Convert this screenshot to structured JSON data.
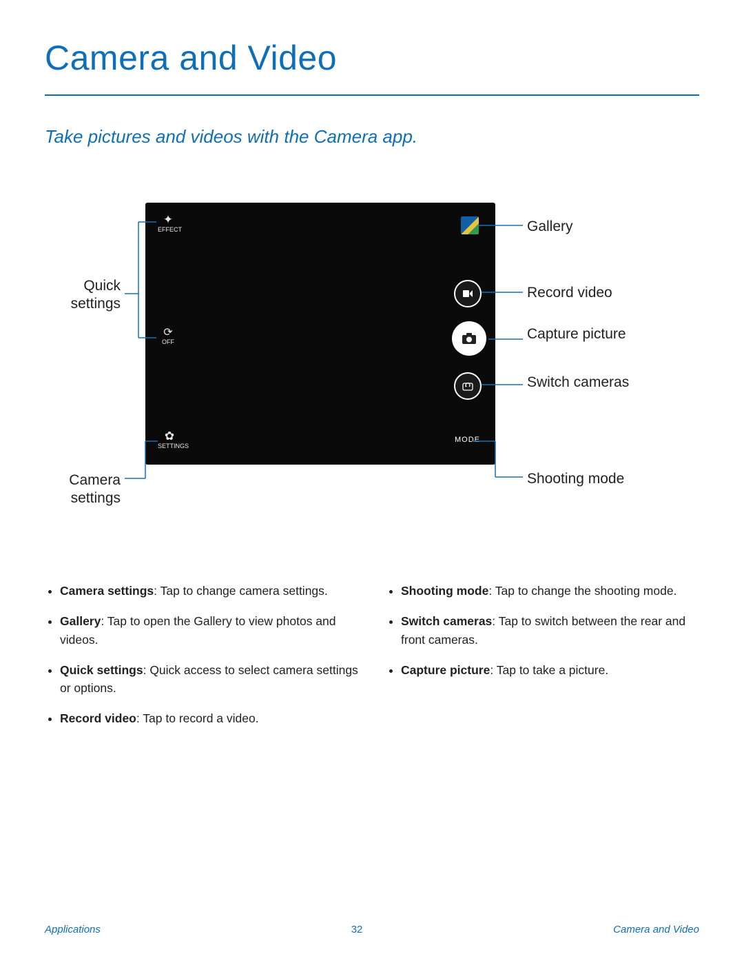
{
  "page_title": "Camera and Video",
  "subhead": "Take pictures and videos with the Camera app.",
  "viewfinder": {
    "effect_label": "EFFECT",
    "timer_label": "OFF",
    "settings_label": "SETTINGS",
    "mode_label": "MODE"
  },
  "callouts": {
    "quick_settings": "Quick settings",
    "camera_settings": "Camera settings",
    "gallery": "Gallery",
    "record_video": "Record video",
    "capture_picture": "Capture picture",
    "switch_cameras": "Switch cameras",
    "shooting_mode": "Shooting mode"
  },
  "list": {
    "left": [
      {
        "term": "Camera settings",
        "desc": ": Tap to change camera settings."
      },
      {
        "term": "Gallery",
        "desc": ": Tap to open the Gallery to view photos and videos."
      },
      {
        "term": "Quick settings",
        "desc": ": Quick access to select camera settings or options."
      },
      {
        "term": "Record video",
        "desc": ": Tap to record a video."
      }
    ],
    "right": [
      {
        "term": "Shooting mode",
        "desc": ": Tap to change the shooting mode."
      },
      {
        "term": "Switch cameras",
        "desc": ": Tap to switch between the rear and front cameras."
      },
      {
        "term": "Capture picture",
        "desc": ": Tap to take a picture."
      }
    ]
  },
  "footer": {
    "left": "Applications",
    "page": "32",
    "right": "Camera and Video"
  }
}
